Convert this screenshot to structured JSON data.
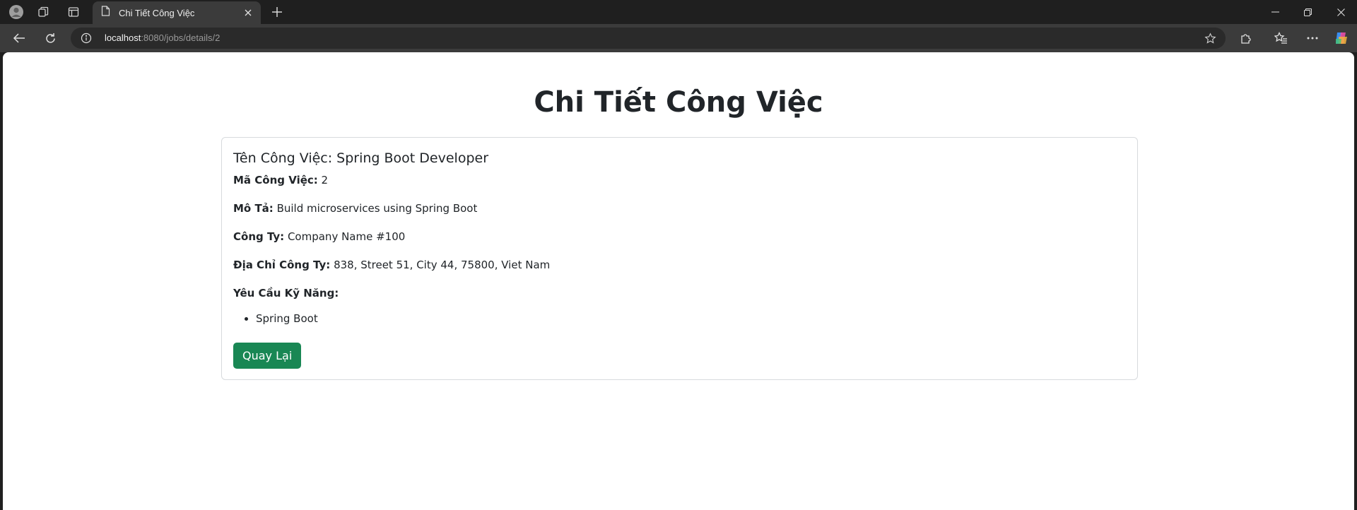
{
  "browser": {
    "tab_title": "Chi Tiết Công Việc",
    "url_host": "localhost",
    "url_rest": ":8080/jobs/details/2"
  },
  "page": {
    "heading": "Chi Tiết Công Việc",
    "card_title": "Tên Công Việc: Spring Boot Developer",
    "fields": {
      "job_id_label": "Mã Công Việc:",
      "job_id_value": " 2",
      "desc_label": "Mô Tả:",
      "desc_value": " Build microservices using Spring Boot",
      "company_label": "Công Ty:",
      "company_value": " Company Name #100",
      "address_label": "Địa Chỉ Công Ty:",
      "address_value": " 838, Street 51, City 44, 75800, Viet Nam",
      "skills_label": "Yêu Cầu Kỹ Năng:"
    },
    "skills": [
      "Spring Boot"
    ],
    "back_button": "Quay Lại"
  },
  "colors": {
    "button_bg": "#198754",
    "tabbar_bg": "#1f1f1f",
    "toolbar_bg": "#3b3b3b"
  }
}
